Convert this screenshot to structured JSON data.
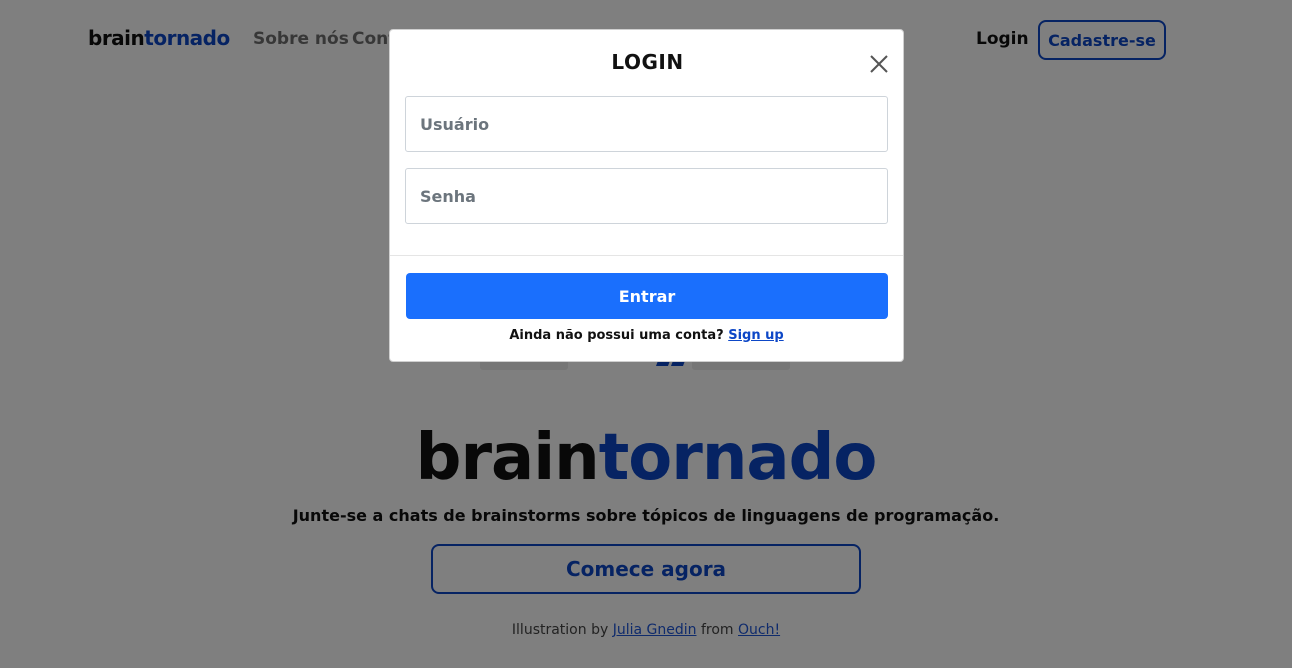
{
  "navbar": {
    "brand_part1": "brain",
    "brand_part2": "tornado",
    "links": [
      "Sobre nós",
      "Cont"
    ],
    "login_label": "Login",
    "signup_label": "Cadastre-se"
  },
  "hero": {
    "title_part1": "brain",
    "title_part2": "tornado",
    "subtitle": "Junte-se a chats de brainstorms sobre tópicos de linguagens de programação.",
    "cta_label": "Comece agora",
    "credits_prefix": "Illustration by",
    "credits_author": "Julia Gnedin",
    "credits_mid": "from",
    "credits_source": "Ouch!"
  },
  "modal": {
    "title": "LOGIN",
    "username_placeholder": "Usuário",
    "password_placeholder": "Senha",
    "submit_label": "Entrar",
    "no_account_text": "Ainda não possui uma conta?",
    "signup_link": "Sign up"
  },
  "colors": {
    "brand_blue": "#0d47c7",
    "primary_button": "#1a6ffd",
    "backdrop": "rgba(0,0,0,0.5)"
  },
  "icons": {
    "close": "close-icon"
  }
}
